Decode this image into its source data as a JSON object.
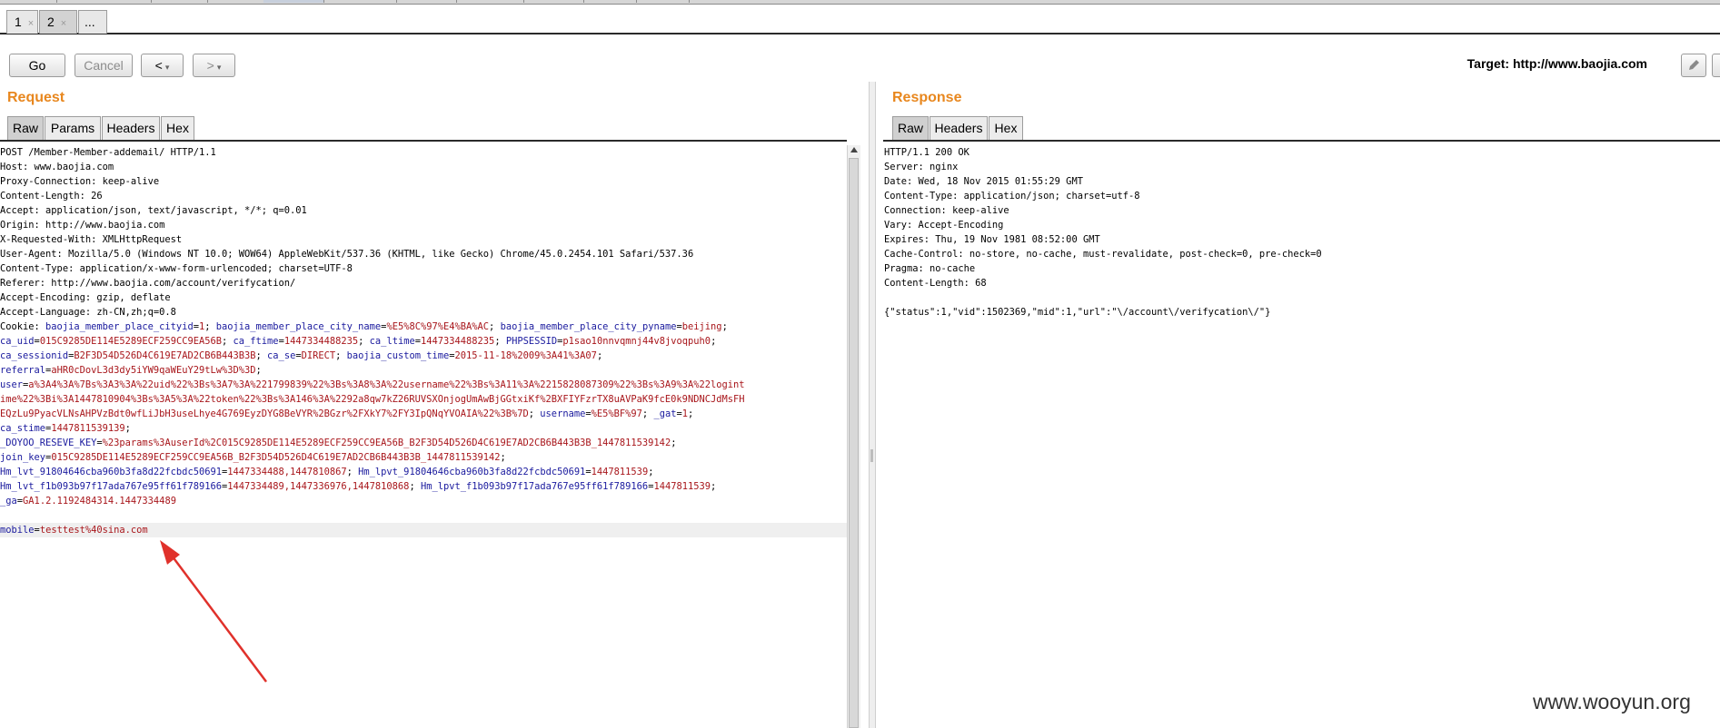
{
  "subtabs": [
    {
      "label": "1",
      "close": "×"
    },
    {
      "label": "2",
      "close": "×"
    },
    {
      "label": "..."
    }
  ],
  "toolbar": {
    "go": "Go",
    "cancel": "Cancel",
    "back": "<",
    "forward": ">",
    "dropdown": "▾",
    "target": "Target: http://www.baojia.com"
  },
  "request": {
    "title": "Request",
    "tabs": [
      "Raw",
      "Params",
      "Headers",
      "Hex"
    ],
    "lines": [
      [
        {
          "t": "POST /Member-Member-addemail/ HTTP/1.1",
          "c": ""
        }
      ],
      [
        {
          "t": "Host: www.baojia.com",
          "c": ""
        }
      ],
      [
        {
          "t": "Proxy-Connection: keep-alive",
          "c": ""
        }
      ],
      [
        {
          "t": "Content-Length: 26",
          "c": ""
        }
      ],
      [
        {
          "t": "Accept: application/json, text/javascript, */*; q=0.01",
          "c": ""
        }
      ],
      [
        {
          "t": "Origin: http://www.baojia.com",
          "c": ""
        }
      ],
      [
        {
          "t": "X-Requested-With: XMLHttpRequest",
          "c": ""
        }
      ],
      [
        {
          "t": "User-Agent: Mozilla/5.0 (Windows NT 10.0; WOW64) AppleWebKit/537.36 (KHTML, like Gecko) Chrome/45.0.2454.101 Safari/537.36",
          "c": ""
        }
      ],
      [
        {
          "t": "Content-Type: application/x-www-form-urlencoded; charset=UTF-8",
          "c": ""
        }
      ],
      [
        {
          "t": "Referer: http://www.baojia.com/account/verifycation/",
          "c": ""
        }
      ],
      [
        {
          "t": "Accept-Encoding: gzip, deflate",
          "c": ""
        }
      ],
      [
        {
          "t": "Accept-Language: zh-CN,zh;q=0.8",
          "c": ""
        }
      ],
      [
        {
          "t": "Cookie: ",
          "c": ""
        },
        {
          "t": "baojia_member_place_cityid",
          "c": "k"
        },
        {
          "t": "=",
          "c": ""
        },
        {
          "t": "1",
          "c": "v"
        },
        {
          "t": "; ",
          "c": ""
        },
        {
          "t": "baojia_member_place_city_name",
          "c": "k"
        },
        {
          "t": "=",
          "c": ""
        },
        {
          "t": "%E5%8C%97%E4%BA%AC",
          "c": "v"
        },
        {
          "t": "; ",
          "c": ""
        },
        {
          "t": "baojia_member_place_city_pyname",
          "c": "k"
        },
        {
          "t": "=",
          "c": ""
        },
        {
          "t": "beijing",
          "c": "v"
        },
        {
          "t": ";",
          "c": ""
        }
      ],
      [
        {
          "t": "ca_uid",
          "c": "k"
        },
        {
          "t": "=",
          "c": ""
        },
        {
          "t": "015C9285DE114E5289ECF259CC9EA56B",
          "c": "v"
        },
        {
          "t": "; ",
          "c": ""
        },
        {
          "t": "ca_ftime",
          "c": "k"
        },
        {
          "t": "=",
          "c": ""
        },
        {
          "t": "1447334488235",
          "c": "v"
        },
        {
          "t": "; ",
          "c": ""
        },
        {
          "t": "ca_ltime",
          "c": "k"
        },
        {
          "t": "=",
          "c": ""
        },
        {
          "t": "1447334488235",
          "c": "v"
        },
        {
          "t": "; ",
          "c": ""
        },
        {
          "t": "PHPSESSID",
          "c": "k"
        },
        {
          "t": "=",
          "c": ""
        },
        {
          "t": "p1sao10nnvqmnj44v8jvoqpuh0",
          "c": "v"
        },
        {
          "t": ";",
          "c": ""
        }
      ],
      [
        {
          "t": "ca_sessionid",
          "c": "k"
        },
        {
          "t": "=",
          "c": ""
        },
        {
          "t": "B2F3D54D526D4C619E7AD2CB6B443B3B",
          "c": "v"
        },
        {
          "t": "; ",
          "c": ""
        },
        {
          "t": "ca_se",
          "c": "k"
        },
        {
          "t": "=",
          "c": ""
        },
        {
          "t": "DIRECT",
          "c": "v"
        },
        {
          "t": "; ",
          "c": ""
        },
        {
          "t": "baojia_custom_time",
          "c": "k"
        },
        {
          "t": "=",
          "c": ""
        },
        {
          "t": "2015-11-18%2009%3A41%3A07",
          "c": "v"
        },
        {
          "t": ";",
          "c": ""
        }
      ],
      [
        {
          "t": "referral",
          "c": "k"
        },
        {
          "t": "=",
          "c": ""
        },
        {
          "t": "aHR0cDovL3d3dy5iYW9qaWEuY29tLw%3D%3D",
          "c": "v"
        },
        {
          "t": ";",
          "c": ""
        }
      ],
      [
        {
          "t": "user",
          "c": "k"
        },
        {
          "t": "=",
          "c": ""
        },
        {
          "t": "a%3A4%3A%7Bs%3A3%3A%22uid%22%3Bs%3A7%3A%221799839%22%3Bs%3A8%3A%22username%22%3Bs%3A11%3A%2215828087309%22%3Bs%3A9%3A%22logint",
          "c": "v"
        }
      ],
      [
        {
          "t": "ime%22%3Bi%3A1447810904%3Bs%3A5%3A%22token%22%3Bs%3A146%3A%2292a8qw7kZ26RUVSXOnjogUmAwBjGGtxiKf%2BXFIYFzrTX8uAVPaK9fcE0k9NDNCJdMsFH",
          "c": "v"
        }
      ],
      [
        {
          "t": "EQzLu9PyacVLNsAHPVzBdt0wfLiJbH3useLhye4G769EyzDYG8BeVYR%2BGzr%2FXkY7%2FY3IpQNqYVOAIA%22%3B%7D",
          "c": "v"
        },
        {
          "t": "; ",
          "c": ""
        },
        {
          "t": "username",
          "c": "k"
        },
        {
          "t": "=",
          "c": ""
        },
        {
          "t": "%E5%BF%97",
          "c": "v"
        },
        {
          "t": "; ",
          "c": ""
        },
        {
          "t": "_gat",
          "c": "k"
        },
        {
          "t": "=",
          "c": ""
        },
        {
          "t": "1",
          "c": "v"
        },
        {
          "t": ";",
          "c": ""
        }
      ],
      [
        {
          "t": "ca_stime",
          "c": "k"
        },
        {
          "t": "=",
          "c": ""
        },
        {
          "t": "1447811539139",
          "c": "v"
        },
        {
          "t": ";",
          "c": ""
        }
      ],
      [
        {
          "t": "_DOYOO_RESEVE_KEY",
          "c": "k"
        },
        {
          "t": "=",
          "c": ""
        },
        {
          "t": "%23params%3AuserId%2C015C9285DE114E5289ECF259CC9EA56B_B2F3D54D526D4C619E7AD2CB6B443B3B_1447811539142",
          "c": "v"
        },
        {
          "t": ";",
          "c": ""
        }
      ],
      [
        {
          "t": "join_key",
          "c": "k"
        },
        {
          "t": "=",
          "c": ""
        },
        {
          "t": "015C9285DE114E5289ECF259CC9EA56B_B2F3D54D526D4C619E7AD2CB6B443B3B_1447811539142",
          "c": "v"
        },
        {
          "t": ";",
          "c": ""
        }
      ],
      [
        {
          "t": "Hm_lvt_91804646cba960b3fa8d22fcbdc50691",
          "c": "k"
        },
        {
          "t": "=",
          "c": ""
        },
        {
          "t": "1447334488,1447810867",
          "c": "v"
        },
        {
          "t": "; ",
          "c": ""
        },
        {
          "t": "Hm_lpvt_91804646cba960b3fa8d22fcbdc50691",
          "c": "k"
        },
        {
          "t": "=",
          "c": ""
        },
        {
          "t": "1447811539",
          "c": "v"
        },
        {
          "t": ";",
          "c": ""
        }
      ],
      [
        {
          "t": "Hm_lvt_f1b093b97f17ada767e95ff61f789166",
          "c": "k"
        },
        {
          "t": "=",
          "c": ""
        },
        {
          "t": "1447334489,1447336976,1447810868",
          "c": "v"
        },
        {
          "t": "; ",
          "c": ""
        },
        {
          "t": "Hm_lpvt_f1b093b97f17ada767e95ff61f789166",
          "c": "k"
        },
        {
          "t": "=",
          "c": ""
        },
        {
          "t": "1447811539",
          "c": "v"
        },
        {
          "t": ";",
          "c": ""
        }
      ],
      [
        {
          "t": "_ga",
          "c": "k"
        },
        {
          "t": "=",
          "c": ""
        },
        {
          "t": "GA1.2.1192484314.1447334489",
          "c": "v"
        }
      ],
      [
        {
          "t": "",
          "c": ""
        }
      ],
      [
        {
          "t": "mobile",
          "c": "k"
        },
        {
          "t": "=",
          "c": ""
        },
        {
          "t": "testtest%40sina.com",
          "c": "v"
        }
      ]
    ]
  },
  "response": {
    "title": "Response",
    "tabs": [
      "Raw",
      "Headers",
      "Hex"
    ],
    "lines": [
      "HTTP/1.1 200 OK",
      "Server: nginx",
      "Date: Wed, 18 Nov 2015 01:55:29 GMT",
      "Content-Type: application/json; charset=utf-8",
      "Connection: keep-alive",
      "Vary: Accept-Encoding",
      "Expires: Thu, 19 Nov 1981 08:52:00 GMT",
      "Cache-Control: no-store, no-cache, must-revalidate, post-check=0, pre-check=0",
      "Pragma: no-cache",
      "Content-Length: 68",
      "",
      "{\"status\":1,\"vid\":1502369,\"mid\":1,\"url\":\"\\/account\\/verifycation\\/\"}"
    ]
  },
  "watermark": "www.wooyun.org",
  "colors": {
    "accent_title": "#e8871e",
    "param_key": "#1a1a9e",
    "param_value": "#a8161b",
    "annotation_arrow": "#e0312b"
  }
}
